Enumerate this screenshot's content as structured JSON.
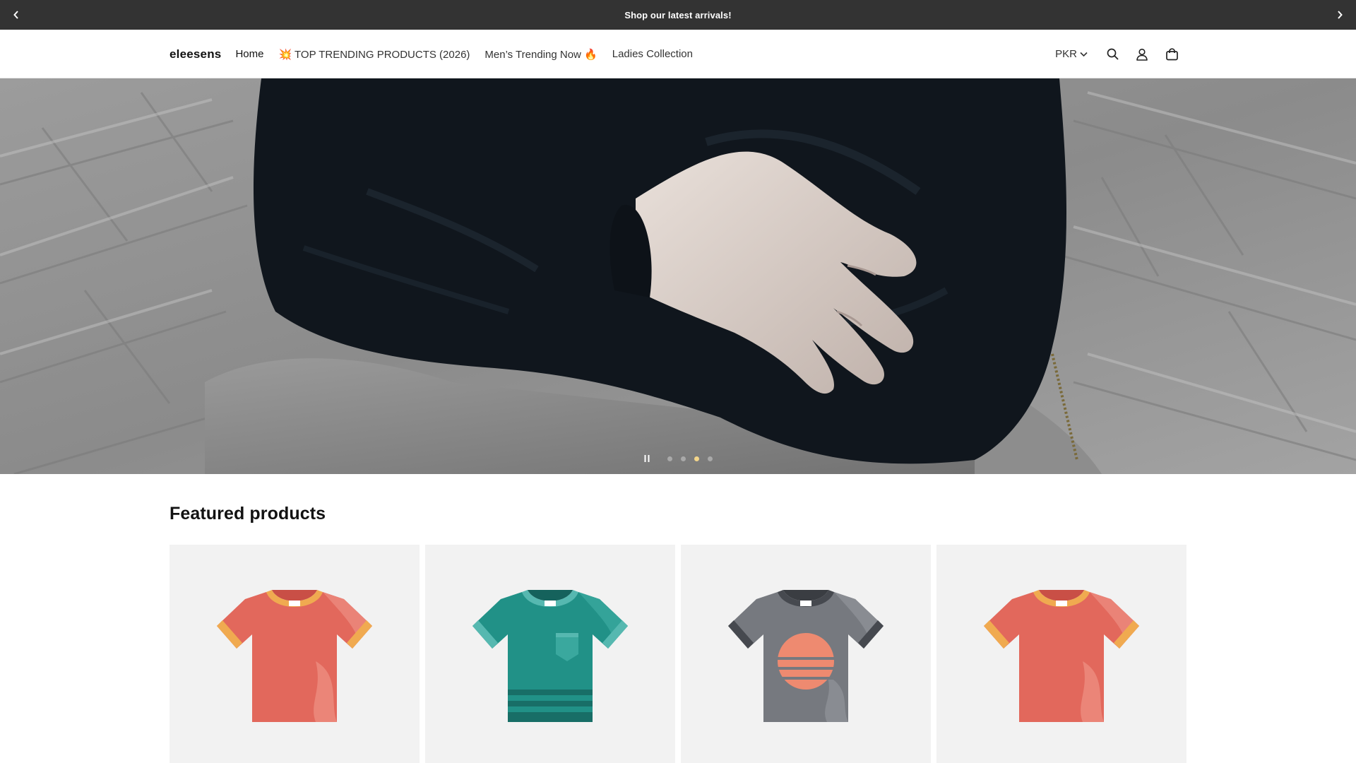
{
  "announcement": {
    "text": "Shop our latest arrivals!",
    "prev_icon": "chevron-left-icon",
    "next_icon": "chevron-right-icon"
  },
  "header": {
    "logo": "eleesens",
    "nav": [
      {
        "label": "Home"
      },
      {
        "label": "💥 TOP TRENDING PRODUCTS (2026)"
      },
      {
        "label": "Men’s Trending Now 🔥"
      },
      {
        "label": "Ladies Collection"
      }
    ],
    "currency": "PKR",
    "icons": [
      "chevron-down-icon",
      "search-icon",
      "account-icon",
      "cart-icon"
    ]
  },
  "hero": {
    "image": "person-in-black-sweater-photo",
    "slides_total": 4,
    "active_slide": 3,
    "pause_icon": "pause-icon"
  },
  "featured": {
    "title": "Featured products",
    "products": [
      {
        "image": "orange-tshirt",
        "body_color": "#e2685c",
        "trim_color": "#f0aa50"
      },
      {
        "image": "teal-pocket-striped-tshirt",
        "body_color": "#219187",
        "trim_color": "#56b8b0"
      },
      {
        "image": "grey-sunset-tshirt",
        "body_color": "#76797f",
        "trim_color": "#46494f"
      },
      {
        "image": "orange-tshirt",
        "body_color": "#e2685c",
        "trim_color": "#f0aa50"
      }
    ]
  },
  "colors": {
    "announcement_bg": "#333333",
    "card_bg": "#f2f2f2",
    "active_dot": "#f3d58a"
  }
}
